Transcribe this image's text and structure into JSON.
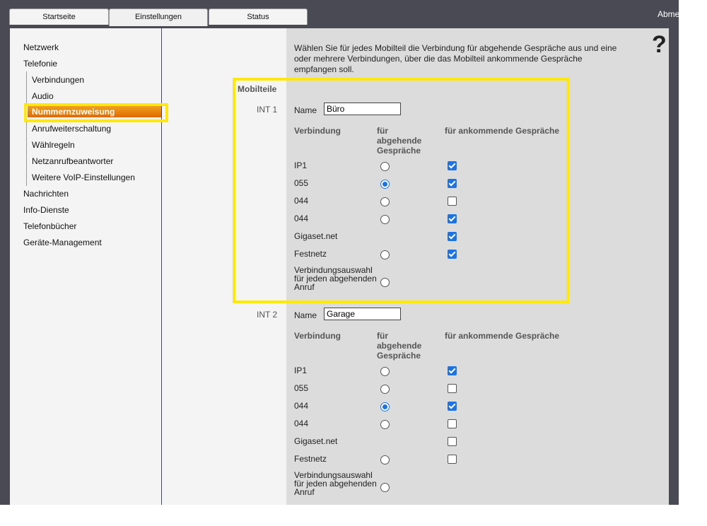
{
  "tabs": [
    "Startseite",
    "Einstellungen",
    "Status"
  ],
  "logout": "Abmelden",
  "help": "?",
  "nav": {
    "items": [
      "Netzwerk",
      "Telefonie"
    ],
    "telefonie_sub": [
      "Verbindungen",
      "Audio",
      "Nummernzuweisung",
      "Anrufweiterschaltung",
      "Wählregeln",
      "Netzanrufbeantworter",
      "Weitere VoIP-Einstellungen"
    ],
    "more": [
      "Nachrichten",
      "Info-Dienste",
      "Telefonbücher",
      "Geräte-Management"
    ]
  },
  "intro": "Wählen Sie für jedes Mobilteil die Verbindung für abgehende Gespräche aus und eine oder mehrere Verbindungen, über die das Mobilteil ankommende Gespräche empfangen soll.",
  "section_title": "Mobilteile",
  "headers": {
    "name": "Name",
    "connection": "Verbindung",
    "outgoing": "für\nabgehende\nGespräche",
    "incoming": "für ankommende Gespräche"
  },
  "handsets": [
    {
      "id": "INT 1",
      "name": "Büro",
      "rows": [
        {
          "label": "IP1",
          "outgoing": false,
          "incoming": true
        },
        {
          "label": "055",
          "outgoing": true,
          "incoming": true
        },
        {
          "label": "044",
          "outgoing": false,
          "incoming": false
        },
        {
          "label": "044",
          "outgoing": false,
          "incoming": true
        },
        {
          "label": "Gigaset.net",
          "outgoing": null,
          "incoming": true
        },
        {
          "label": "Festnetz",
          "outgoing": false,
          "incoming": true
        },
        {
          "label": "Verbindungsauswahl\nfür jeden abgehenden\nAnruf",
          "outgoing": false,
          "incoming": null
        }
      ]
    },
    {
      "id": "INT 2",
      "name": "Garage",
      "rows": [
        {
          "label": "IP1",
          "outgoing": false,
          "incoming": true
        },
        {
          "label": "055",
          "outgoing": false,
          "incoming": false
        },
        {
          "label": "044",
          "outgoing": true,
          "incoming": true
        },
        {
          "label": "044",
          "outgoing": false,
          "incoming": false
        },
        {
          "label": "Gigaset.net",
          "outgoing": null,
          "incoming": false
        },
        {
          "label": "Festnetz",
          "outgoing": false,
          "incoming": false
        },
        {
          "label": "Verbindungsauswahl\nfür jeden abgehenden\nAnruf",
          "outgoing": false,
          "incoming": null
        }
      ]
    }
  ],
  "colors": {
    "accent_selected": "#e06a00",
    "highlight": "#ffe80a",
    "frame": "#4a4a55",
    "control_on": "#1a73e8"
  }
}
